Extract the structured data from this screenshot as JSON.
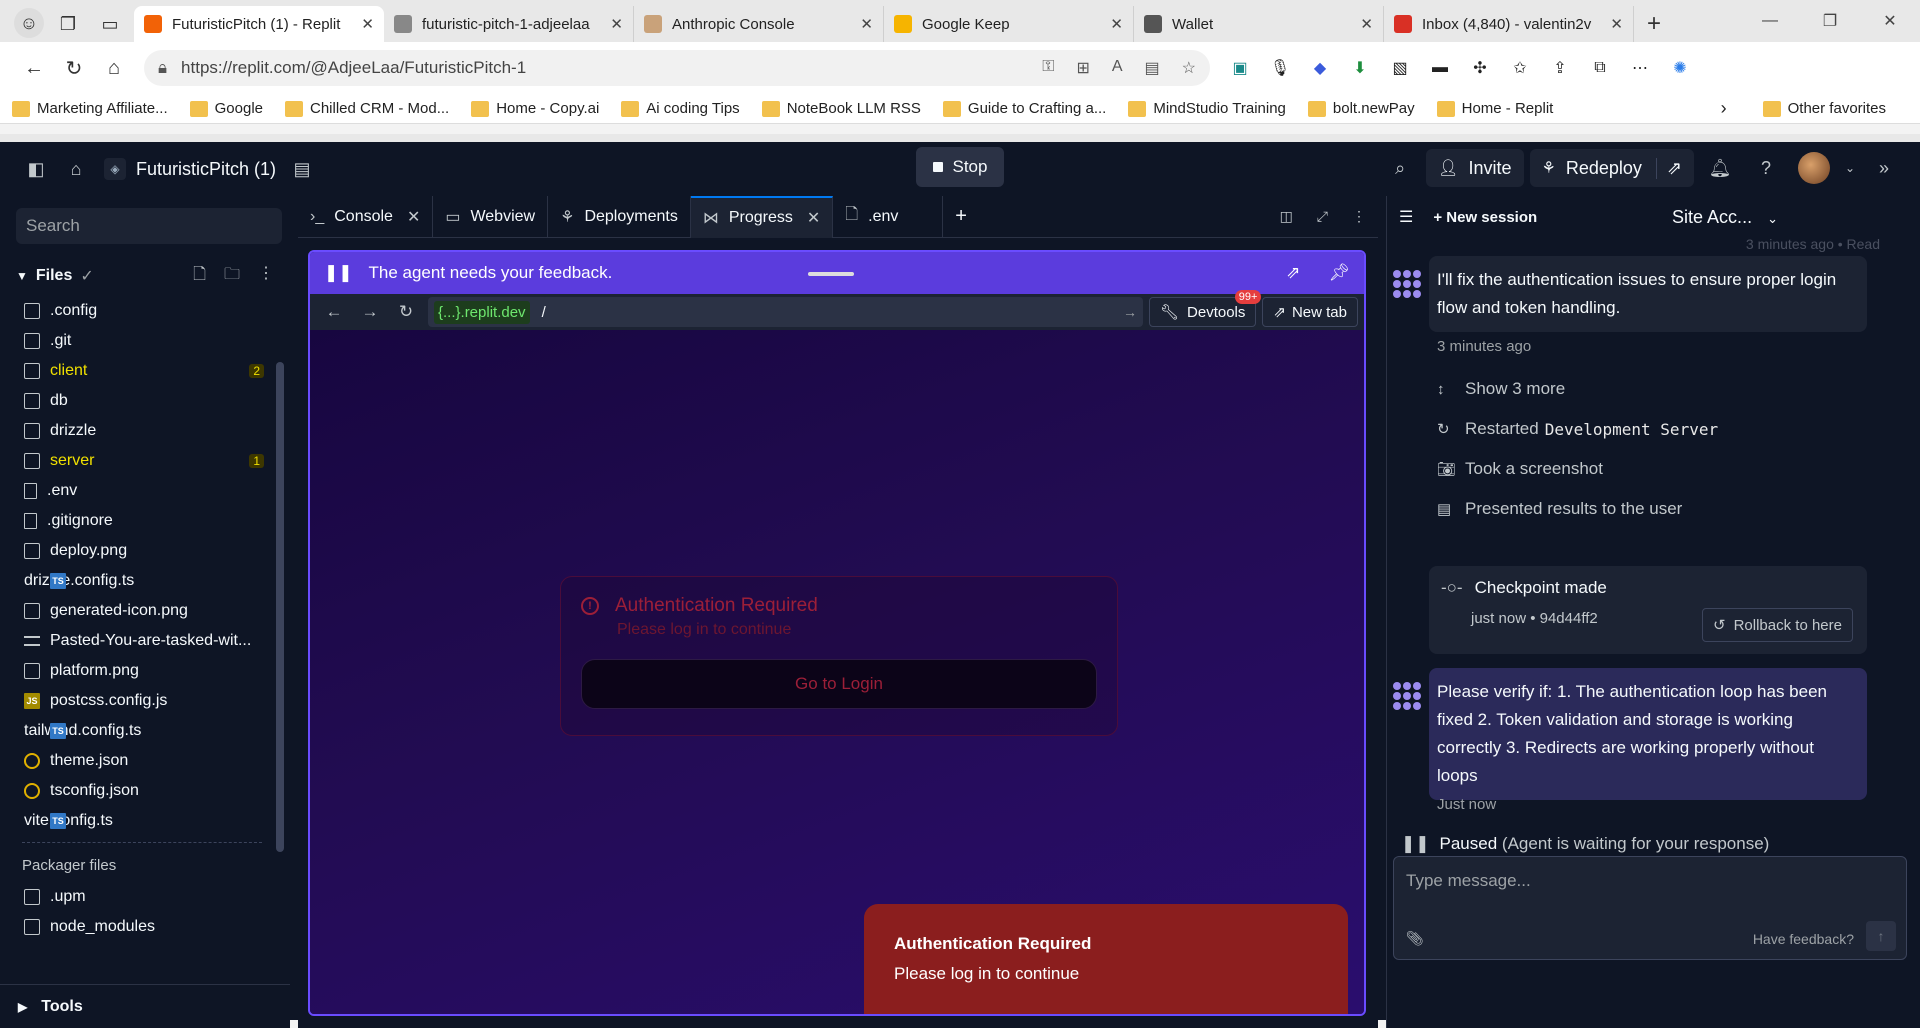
{
  "browser": {
    "tabs": [
      {
        "title": "FuturisticPitch (1) - Replit",
        "active": true,
        "favicon_color": "#f26207"
      },
      {
        "title": "futuristic-pitch-1-adjeelaa",
        "active": false,
        "favicon_color": "#888888"
      },
      {
        "title": "Anthropic Console",
        "active": false,
        "favicon_color": "#c9a27a"
      },
      {
        "title": "Google Keep",
        "active": false,
        "favicon_color": "#f6b400"
      },
      {
        "title": "Wallet",
        "active": false,
        "favicon_color": "#555555"
      },
      {
        "title": "Inbox (4,840) - valentin2v",
        "active": false,
        "favicon_color": "#d93025"
      }
    ],
    "url": "https://replit.com/@AdjeeLaa/FuturisticPitch-1",
    "bookmarks": [
      {
        "label": "Marketing Affiliate..."
      },
      {
        "label": "Google"
      },
      {
        "label": "Chilled CRM - Mod..."
      },
      {
        "label": "Home - Copy.ai"
      },
      {
        "label": "Ai coding Tips"
      },
      {
        "label": "NoteBook LLM RSS"
      },
      {
        "label": "Guide to Crafting a..."
      },
      {
        "label": "MindStudio Training"
      },
      {
        "label": "bolt.newPay"
      },
      {
        "label": "Home - Replit"
      }
    ],
    "other_favorites": "Other favorites"
  },
  "replit": {
    "project_name": "FuturisticPitch (1)",
    "stop_label": "Stop",
    "invite_label": "Invite",
    "redeploy_label": "Redeploy"
  },
  "files": {
    "search_placeholder": "Search",
    "header": "Files",
    "items": [
      {
        "name": ".config",
        "type": "folder"
      },
      {
        "name": ".git",
        "type": "folder"
      },
      {
        "name": "client",
        "type": "folder",
        "badge": "2"
      },
      {
        "name": "db",
        "type": "folder"
      },
      {
        "name": "drizzle",
        "type": "folder"
      },
      {
        "name": "server",
        "type": "folder",
        "badge": "1"
      },
      {
        "name": ".env",
        "type": "file"
      },
      {
        "name": ".gitignore",
        "type": "file"
      },
      {
        "name": "deploy.png",
        "type": "image"
      },
      {
        "name": "drizzle.config.ts",
        "type": "ts"
      },
      {
        "name": "generated-icon.png",
        "type": "image"
      },
      {
        "name": "Pasted-You-are-tasked-wit...",
        "type": "text"
      },
      {
        "name": "platform.png",
        "type": "image"
      },
      {
        "name": "postcss.config.js",
        "type": "js"
      },
      {
        "name": "tailwind.config.ts",
        "type": "ts"
      },
      {
        "name": "theme.json",
        "type": "json"
      },
      {
        "name": "tsconfig.json",
        "type": "json"
      },
      {
        "name": "vite.config.ts",
        "type": "ts"
      }
    ],
    "packager_header": "Packager files",
    "packager_items": [
      {
        "name": ".upm",
        "type": "folder"
      },
      {
        "name": "node_modules",
        "type": "folder"
      }
    ],
    "tools_label": "Tools"
  },
  "workspace": {
    "tabs": [
      {
        "label": "Console",
        "icon": "terminal-icon",
        "closable": true
      },
      {
        "label": "Webview",
        "icon": "monitor-icon",
        "closable": false
      },
      {
        "label": "Deployments",
        "icon": "rocket-icon",
        "closable": false
      },
      {
        "label": "Progress",
        "icon": "progress-icon",
        "closable": true,
        "active": true
      },
      {
        "label": ".env",
        "icon": "file-icon",
        "closable": false
      }
    ],
    "feedback_banner": "The agent needs your feedback.",
    "webview": {
      "domain": "{...}.replit.dev",
      "path": "/",
      "devtools_label": "Devtools",
      "devtools_badge": "99+",
      "newtab_label": "New tab"
    },
    "preview": {
      "auth_title": "Authentication Required",
      "auth_sub": "Please log in to continue",
      "login_button": "Go to Login",
      "toast_title": "Authentication Required",
      "toast_sub": "Please log in to continue"
    }
  },
  "agent": {
    "new_session": "New session",
    "site_label": "Site Acc...",
    "faded_time": "3 minutes ago • Read",
    "message1": "I'll fix the authentication issues to ensure proper login flow and token handling.",
    "message1_time": "3 minutes ago",
    "show_more": "Show 3 more",
    "restarted_label": "Restarted",
    "restarted_code": "Development Server",
    "screenshot_label": "Took a screenshot",
    "presented_label": "Presented results to the user",
    "checkpoint_title": "Checkpoint made",
    "checkpoint_meta": "just now • 94d44ff2",
    "rollback_label": "Rollback to here",
    "message2": "Please verify if: 1. The authentication loop has been fixed 2. Token validation and storage is working correctly 3. Redirects are working properly without loops",
    "message2_time": "Just now",
    "paused_label": "Paused",
    "paused_detail": "(Agent is waiting for your response)",
    "input_placeholder": "Type message...",
    "have_feedback": "Have feedback?"
  }
}
